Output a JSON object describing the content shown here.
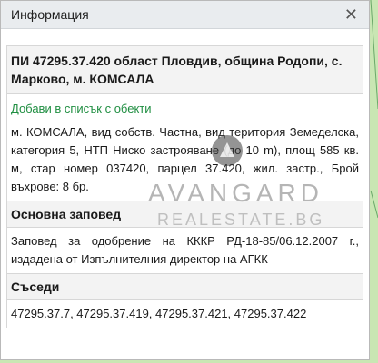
{
  "window": {
    "title": "Информация"
  },
  "parcel": {
    "heading": "ПИ 47295.37.420 област Пловдив, община Родопи, с. Марково, м. КОМСАЛА",
    "add_link": "Добави в списък с обекти",
    "description": "м. КОМСАЛА, вид собств. Частна, вид територия Земеделска, категория 5, НТП Ниско застрояване (до 10 m), площ 585 кв. м, стар номер 037420, парцел 37.420, жил. застр., Брой въхрове: 8 бр."
  },
  "order": {
    "heading": "Основна заповед",
    "text": "Заповед за одобрение на КККР РД-18-85/06.12.2007 г., издадена от Изпълнителния директор на АГКК"
  },
  "neighbors": {
    "heading": "Съседи",
    "text": "47295.37.7, 47295.37.419, 47295.37.421, 47295.37.422"
  },
  "watermark": {
    "name": "AVANGARD",
    "sub": "REALESTATE.BG"
  },
  "colors": {
    "link": "#1f8e41",
    "map_bg": "#c9e6b3"
  }
}
